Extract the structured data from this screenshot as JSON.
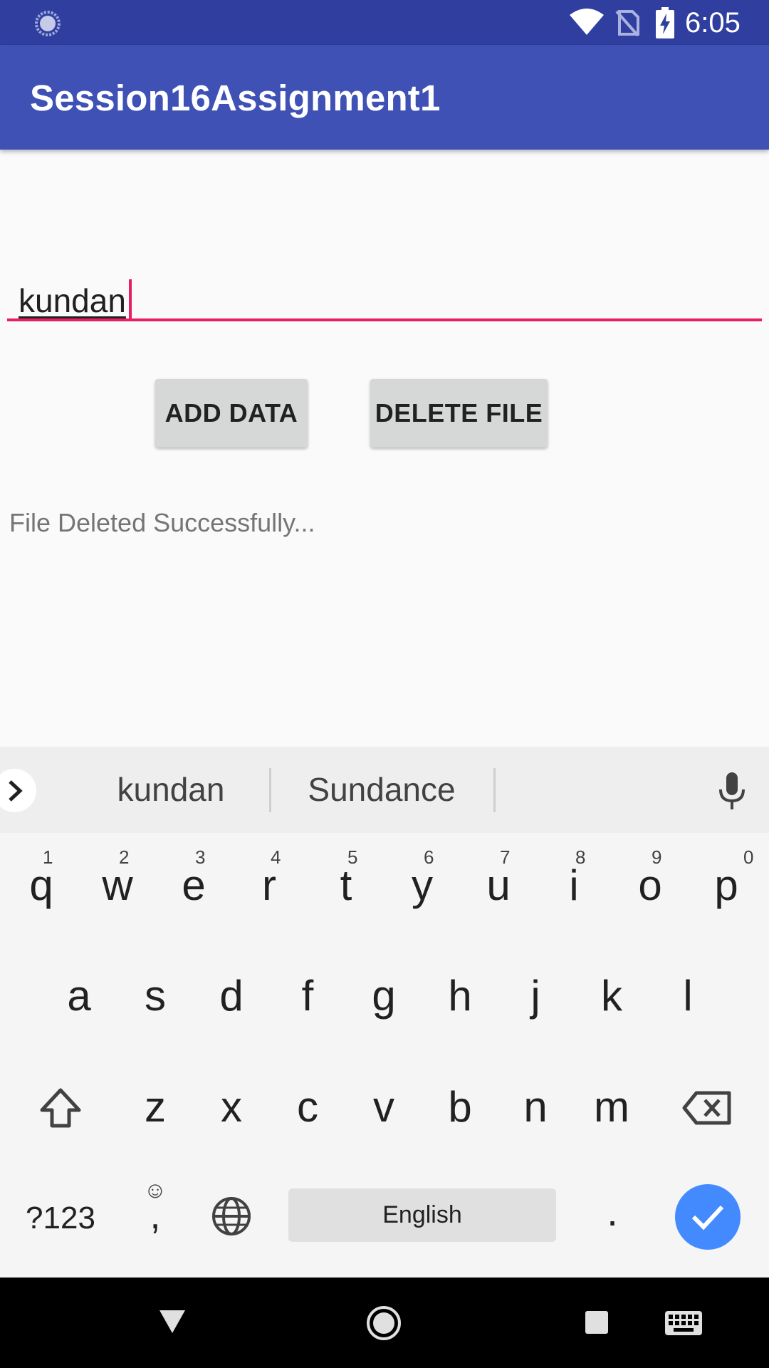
{
  "status_bar": {
    "time": "6:05",
    "icons": [
      "loading-icon",
      "wifi-icon",
      "no-sim-icon",
      "battery-charging-icon"
    ]
  },
  "app_bar": {
    "title": "Session16Assignment1"
  },
  "main": {
    "input_value": "kundan",
    "add_button_label": "ADD DATA",
    "delete_button_label": "DELETE FILE",
    "status_message": "File Deleted Successfully..."
  },
  "keyboard": {
    "suggestions": [
      "kundan",
      "Sundance"
    ],
    "row1": [
      {
        "ch": "q",
        "hint": "1"
      },
      {
        "ch": "w",
        "hint": "2"
      },
      {
        "ch": "e",
        "hint": "3"
      },
      {
        "ch": "r",
        "hint": "4"
      },
      {
        "ch": "t",
        "hint": "5"
      },
      {
        "ch": "y",
        "hint": "6"
      },
      {
        "ch": "u",
        "hint": "7"
      },
      {
        "ch": "i",
        "hint": "8"
      },
      {
        "ch": "o",
        "hint": "9"
      },
      {
        "ch": "p",
        "hint": "0"
      }
    ],
    "row2": [
      "a",
      "s",
      "d",
      "f",
      "g",
      "h",
      "j",
      "k",
      "l"
    ],
    "row3": [
      "z",
      "x",
      "c",
      "v",
      "b",
      "n",
      "m"
    ],
    "symbols_label": "?123",
    "comma_label": ",",
    "emoji_label": "☺",
    "space_label": "English",
    "period_label": ".",
    "accent_color": "#448aff"
  },
  "colors": {
    "status_bar": "#303f9f",
    "app_bar": "#3f51b5",
    "input_accent": "#e91e63"
  }
}
